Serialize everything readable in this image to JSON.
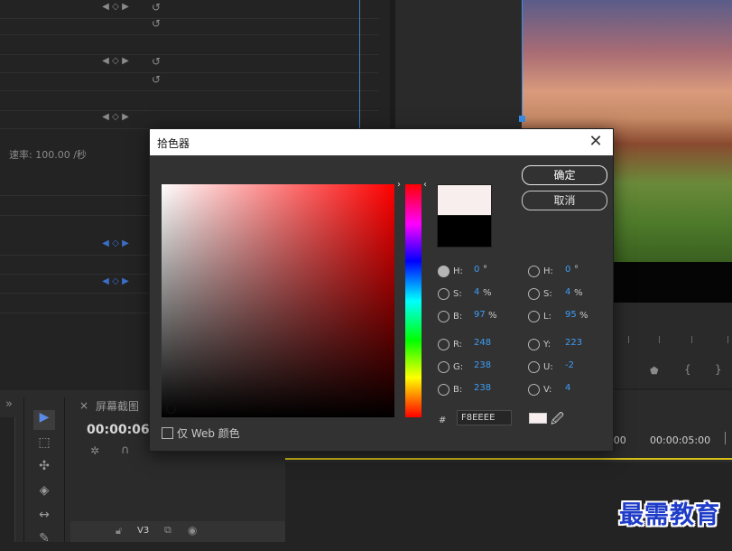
{
  "background": {
    "rate_label": "速率: 100.00 /秒",
    "panel_tab": "屏幕截图",
    "timecode": "00:00:06:",
    "ruler_time": "00:00:05:00",
    "ruler_partial": ":00",
    "track_name": "V3",
    "panel_close": "×",
    "panel_menu": "»"
  },
  "dialog": {
    "title": "拾色器",
    "close_icon": "close-icon",
    "ok_label": "确定",
    "cancel_label": "取消",
    "web_only_label": "仅 Web 颜色",
    "new_color": "#F8EEEE",
    "old_color": "#000000",
    "hex_label": "#",
    "hex_value": "F8EEEE",
    "hsb": {
      "h": {
        "label": "H:",
        "value": "0",
        "unit": "°"
      },
      "s": {
        "label": "S:",
        "value": "4",
        "unit": "%"
      },
      "b": {
        "label": "B:",
        "value": "97",
        "unit": "%"
      }
    },
    "rgb": {
      "r": {
        "label": "R:",
        "value": "248"
      },
      "g": {
        "label": "G:",
        "value": "238"
      },
      "b": {
        "label": "B:",
        "value": "238"
      }
    },
    "hsl": {
      "h": {
        "label": "H:",
        "value": "0",
        "unit": "°"
      },
      "s": {
        "label": "S:",
        "value": "4",
        "unit": "%"
      },
      "l": {
        "label": "L:",
        "value": "95",
        "unit": "%"
      }
    },
    "yuv": {
      "y": {
        "label": "Y:",
        "value": "223"
      },
      "u": {
        "label": "U:",
        "value": "-2"
      },
      "v": {
        "label": "V:",
        "value": "4"
      }
    }
  },
  "watermark": "最需教育",
  "colors": {
    "accent_value": "#3e9cf5",
    "selection_blue": "#3a8ee6",
    "timeline_yellow": "#d7c018"
  }
}
